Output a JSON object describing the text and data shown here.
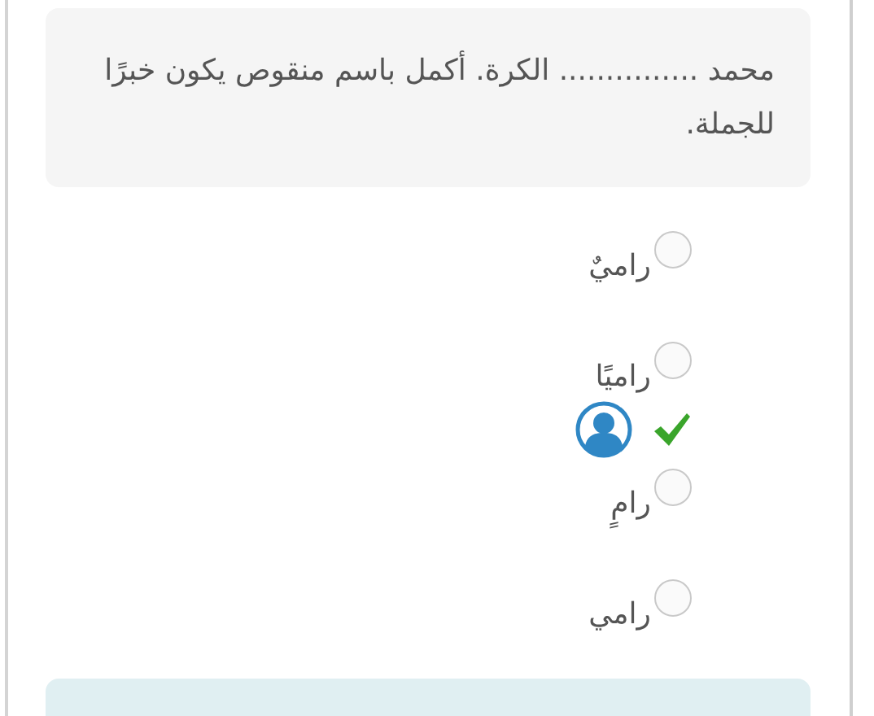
{
  "question": {
    "text": "محمد ............... الكرة. أكمل باسم منقوص يكون خبرًا للجملة."
  },
  "options": [
    {
      "label": "راميٌ",
      "selected": false,
      "answer_mark": false
    },
    {
      "label": "راميًا",
      "selected": false,
      "answer_mark": false
    },
    {
      "label": "رامٍ",
      "selected": false,
      "answer_mark": true
    },
    {
      "label": "رامي",
      "selected": false,
      "answer_mark": false
    }
  ],
  "feedback": {
    "kind": "panel"
  }
}
